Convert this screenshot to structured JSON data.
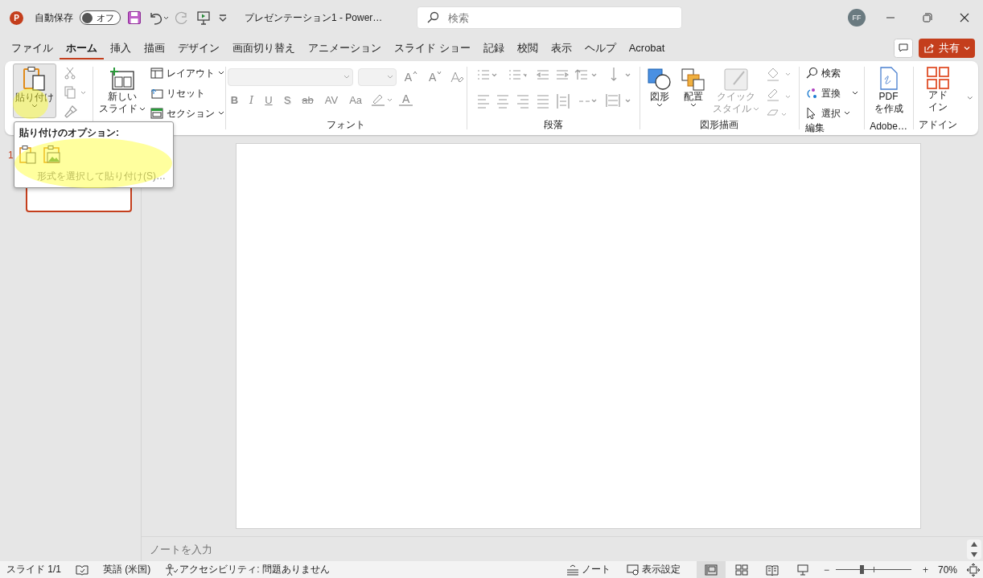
{
  "title_bar": {
    "app_letter": "P",
    "autosave_label": "自動保存",
    "autosave": {
      "on": false,
      "label": "オフ"
    },
    "document_title": "プレゼンテーション1  -  Power…",
    "search": {
      "placeholder": "検索"
    },
    "user_initials": "FF"
  },
  "ribbon_tabs": [
    {
      "label": "ファイル",
      "selected": false
    },
    {
      "label": "ホーム",
      "selected": true
    },
    {
      "label": "挿入",
      "selected": false
    },
    {
      "label": "描画",
      "selected": false
    },
    {
      "label": "デザイン",
      "selected": false
    },
    {
      "label": "画面切り替え",
      "selected": false
    },
    {
      "label": "アニメーション",
      "selected": false
    },
    {
      "label": "スライド ショー",
      "selected": false
    },
    {
      "label": "記録",
      "selected": false
    },
    {
      "label": "校閲",
      "selected": false
    },
    {
      "label": "表示",
      "selected": false
    },
    {
      "label": "ヘルプ",
      "selected": false
    },
    {
      "label": "Acrobat",
      "selected": false
    }
  ],
  "share_button": "共有",
  "ribbon": {
    "clipboard": {
      "paste": "貼り付け",
      "expanded": true
    },
    "slides": {
      "new_slide": [
        "新しい",
        "スライド"
      ],
      "layout": "レイアウト",
      "reset": "リセット",
      "section": "セクション"
    },
    "font": {
      "label": "フォント",
      "grow": "A",
      "shrink": "A",
      "format_buttons": [
        "B",
        "I",
        "U",
        "S",
        "ab",
        "AV",
        "Aa"
      ],
      "font_color": "A"
    },
    "paragraph": {
      "label": "段落"
    },
    "drawing": {
      "label": "図形描画",
      "shapes": "図形",
      "arrange": "配置",
      "quick_styles": [
        "クイック",
        "スタイル"
      ]
    },
    "editing": {
      "label": "編集",
      "find": "検索",
      "replace": "置換",
      "select": "選択"
    },
    "adobe": {
      "label": "Adobe…",
      "create_pdf": [
        "PDF",
        "を作成"
      ]
    },
    "addins": {
      "label": "アドイン",
      "addins": [
        "アド",
        "イン"
      ]
    }
  },
  "paste_menu": {
    "title": "貼り付けのオプション:",
    "special": "形式を選択して貼り付け(S)…"
  },
  "slide_number": "1",
  "notes": {
    "placeholder": "ノートを入力"
  },
  "status_bar": {
    "slide": "スライド 1/1",
    "language": "英語 (米国)",
    "accessibility": "アクセシビリティ: 問題ありません",
    "notes": "ノート",
    "display_settings": "表示設定",
    "views": [
      {
        "kind": "normal",
        "selected": true
      },
      {
        "kind": "sorter",
        "selected": false
      },
      {
        "kind": "reading",
        "selected": false
      },
      {
        "kind": "slideshow",
        "selected": false
      }
    ],
    "zoom_out": "−",
    "zoom_in": "+",
    "zoom": {
      "level": 0.34
    },
    "zoom_value": "70%"
  }
}
